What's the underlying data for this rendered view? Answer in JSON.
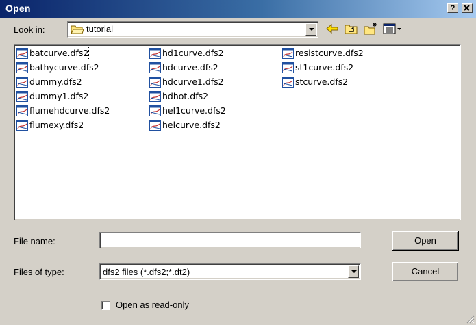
{
  "window": {
    "title": "Open",
    "help_label": "?",
    "close_label": "✕",
    "titlebar_gradient": [
      "#0a246a",
      "#a6caf0"
    ]
  },
  "lookin": {
    "label": "Look in:",
    "value": "tutorial"
  },
  "toolbar": {
    "back_icon": "back-arrow-icon",
    "up_icon": "up-folder-icon",
    "newfolder_icon": "new-folder-icon",
    "view_icon": "view-menu-icon"
  },
  "files": [
    [
      "batcurve.dfs2",
      "bathycurve.dfs2",
      "dummy.dfs2",
      "dummy1.dfs2",
      "flumehdcurve.dfs2",
      "flumexy.dfs2"
    ],
    [
      "hd1curve.dfs2",
      "hdcurve.dfs2",
      "hdcurve1.dfs2",
      "hdhot.dfs2",
      "hel1curve.dfs2",
      "helcurve.dfs2"
    ],
    [
      "resistcurve.dfs2",
      "st1curve.dfs2",
      "stcurve.dfs2"
    ]
  ],
  "filename": {
    "label": "File name:",
    "value": ""
  },
  "filetype": {
    "label": "Files of type:",
    "value": "dfs2 files (*.dfs2;*.dt2)"
  },
  "buttons": {
    "open": "Open",
    "cancel": "Cancel"
  },
  "readonly": {
    "label": "Open as read-only",
    "checked": false
  }
}
